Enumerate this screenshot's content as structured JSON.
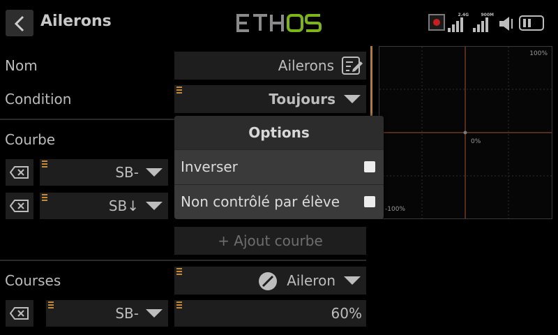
{
  "header": {
    "title": "Ailerons",
    "logo": {
      "text_left": "ETH",
      "text_right": "OS"
    },
    "signal_1_label": "2.4G",
    "signal_2_label": "900M"
  },
  "form": {
    "name_label": "Nom",
    "name_value": "Ailerons",
    "condition_label": "Condition",
    "condition_value": "Toujours",
    "curve_label": "Courbe",
    "curve_rows": [
      {
        "source": "SB-"
      },
      {
        "source": "SB↓"
      }
    ],
    "add_curve_label": "+ Ajout courbe",
    "courses_label": "Courses",
    "courses_source": "Aileron",
    "courses_rows": [
      {
        "source": "SB-",
        "value": "60%"
      }
    ]
  },
  "graph": {
    "top_label": "100%",
    "center_label": "0%",
    "bottom_label": "-100%"
  },
  "popup": {
    "title": "Options",
    "items": [
      {
        "label": "Inverser",
        "checked": false
      },
      {
        "label": "Non contrôlé par élève",
        "checked": false
      }
    ]
  },
  "colors": {
    "accent": "#c68a3a",
    "logo_green": "#7cb518",
    "record": "#c81e1e"
  }
}
